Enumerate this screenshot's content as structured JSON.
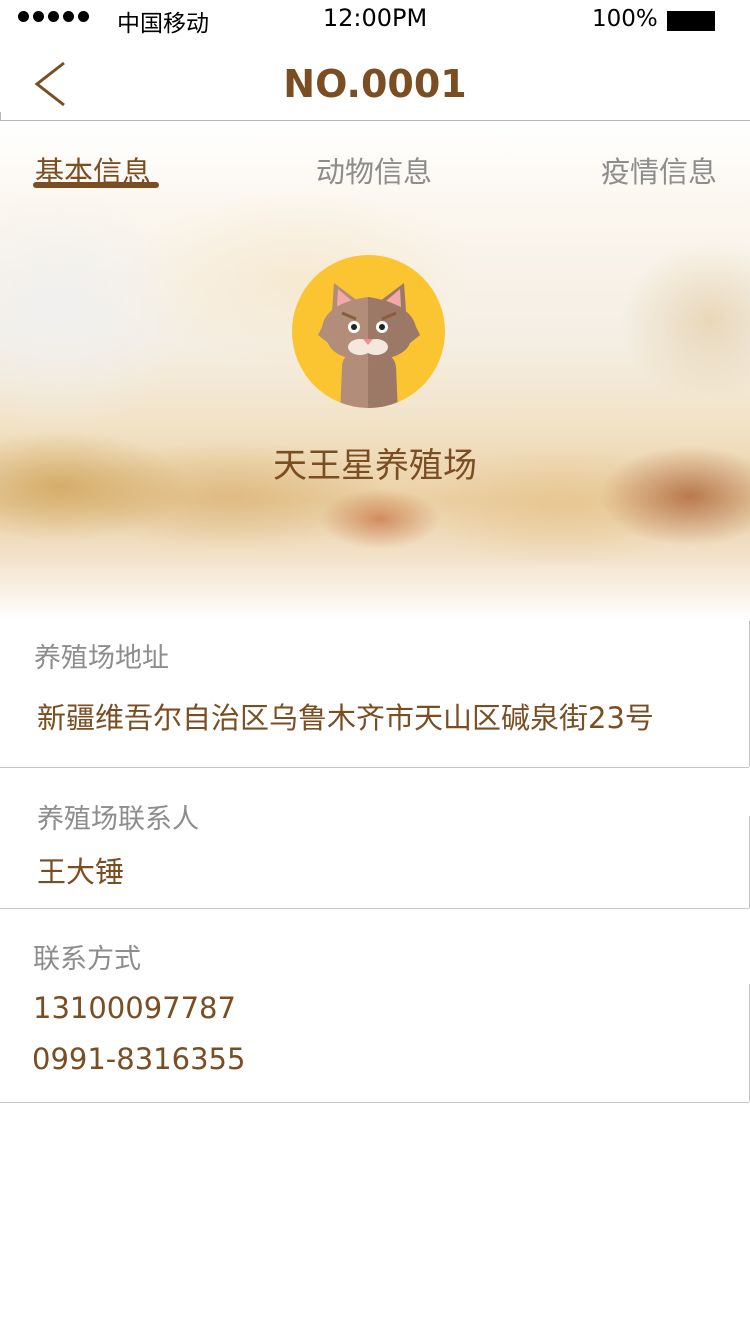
{
  "status_bar": {
    "carrier": "中国移动",
    "time": "12:00PM",
    "battery": "100%"
  },
  "nav": {
    "title": "NO.0001",
    "back_icon": "chevron-left-icon"
  },
  "tabs": [
    {
      "label": "基本信息",
      "active": true
    },
    {
      "label": "动物信息",
      "active": false
    },
    {
      "label": "疫情信息",
      "active": false
    }
  ],
  "profile": {
    "avatar_icon": "cat-avatar-icon",
    "name": "天王星养殖场"
  },
  "info": {
    "address_label": "养殖场地址",
    "address_value": "新疆维吾尔自治区乌鲁木齐市天山区碱泉街23号",
    "contact_label": "养殖场联系人",
    "contact_value": "王大锤",
    "phone_label": "联系方式",
    "phones": [
      "13100097787",
      "0991-8316355"
    ]
  },
  "colors": {
    "accent": "#7a4e22",
    "label_gray": "#8d8d8d",
    "avatar_bg": "#fbc531"
  }
}
